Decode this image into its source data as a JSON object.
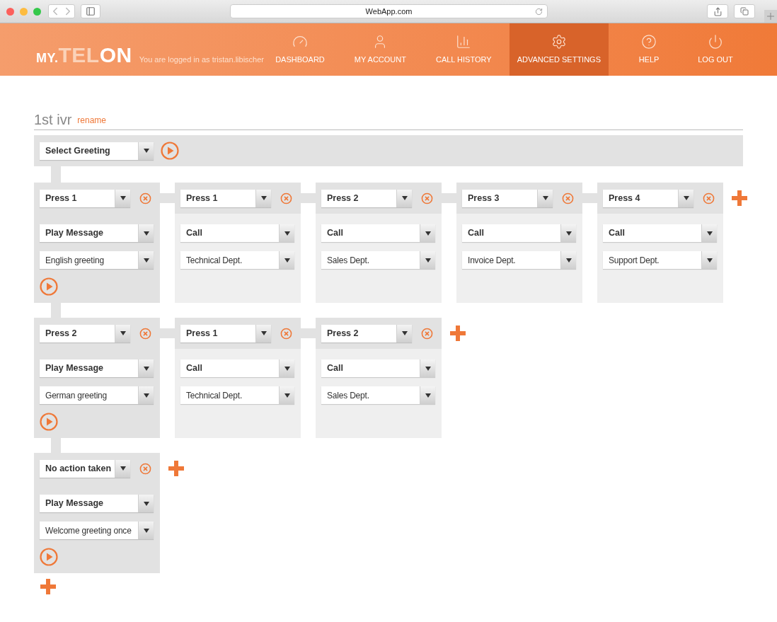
{
  "browser": {
    "url": "WebApp.com"
  },
  "header": {
    "logo": [
      "MY.",
      "TEL",
      "ON"
    ],
    "login_text": "You are logged in as tristan.libischer",
    "nav": [
      {
        "label": "DASHBOARD",
        "selected": false
      },
      {
        "label": "MY ACCOUNT",
        "selected": false
      },
      {
        "label": "CALL HISTORY",
        "selected": false
      },
      {
        "label": "ADVANCED SETTINGS",
        "selected": true
      },
      {
        "label": "HELP",
        "selected": false
      },
      {
        "label": "LOG OUT",
        "selected": false
      }
    ]
  },
  "ivr": {
    "title": "1st ivr",
    "rename": "rename",
    "greeting": "Select Greeting",
    "rows": [
      {
        "trigger": "Press  1",
        "action": "Play Message",
        "target": "English greeting",
        "branches": [
          {
            "trigger": "Press  1",
            "action": "Call",
            "target": "Technical Dept."
          },
          {
            "trigger": "Press  2",
            "action": "Call",
            "target": "Sales Dept."
          },
          {
            "trigger": "Press  3",
            "action": "Call",
            "target": "Invoice Dept."
          },
          {
            "trigger": "Press  4",
            "action": "Call",
            "target": "Support Dept."
          }
        ]
      },
      {
        "trigger": "Press  2",
        "action": "Play Message",
        "target": "German greeting",
        "branches": [
          {
            "trigger": "Press  1",
            "action": "Call",
            "target": "Technical Dept."
          },
          {
            "trigger": "Press  2",
            "action": "Call",
            "target": "Sales Dept."
          }
        ]
      },
      {
        "trigger": "No action taken",
        "action": "Play Message",
        "target": "Welcome greeting once",
        "branches": []
      }
    ]
  }
}
